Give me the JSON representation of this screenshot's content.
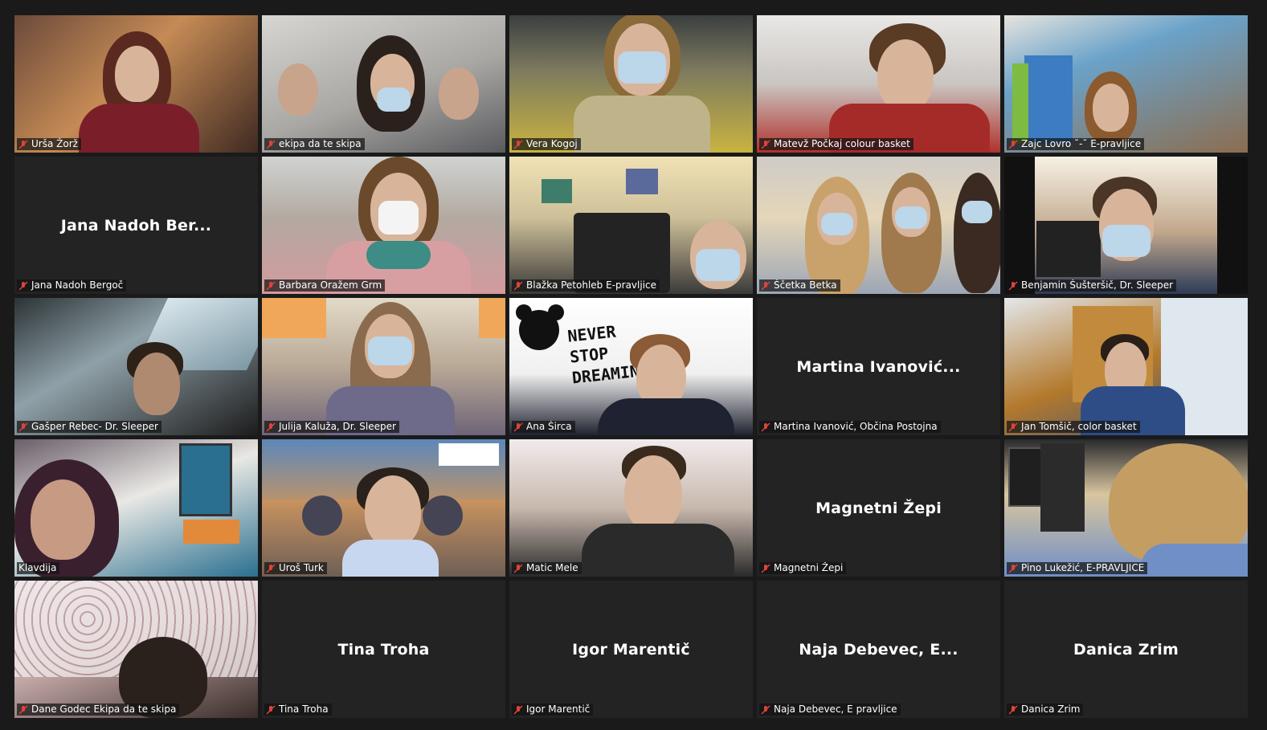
{
  "meeting": {
    "layout": "gallery-view",
    "tiles": [
      {
        "id": "urs",
        "name": "Urša Žorž",
        "display": "video",
        "muted": true
      },
      {
        "id": "ekipa",
        "name": "ekipa da te skipa",
        "display": "video",
        "muted": true
      },
      {
        "id": "vera",
        "name": "Vera Kogoj",
        "display": "video",
        "muted": true
      },
      {
        "id": "matevz",
        "name": "Matevž Počkaj colour basket",
        "display": "video",
        "muted": true
      },
      {
        "id": "zajc",
        "name": "Zajc Lovro ˘-˘  E-pravljice",
        "display": "video",
        "muted": true
      },
      {
        "id": "jana",
        "name": "Jana Nadoh Bergoč",
        "center_name": "Jana Nadoh Ber...",
        "display": "name",
        "muted": true
      },
      {
        "id": "barbara",
        "name": "Barbara Oražem Grm",
        "display": "video",
        "muted": true
      },
      {
        "id": "blazka",
        "name": "Blažka Petohleb E-pravljice",
        "display": "video",
        "muted": true
      },
      {
        "id": "scetka",
        "name": "Ščetka Betka",
        "display": "video",
        "muted": true
      },
      {
        "id": "benjamin",
        "name": "Benjamin Šušteršič, Dr. Sleeper",
        "display": "video",
        "muted": true
      },
      {
        "id": "gasper",
        "name": "Gašper Rebec- Dr. Sleeper",
        "display": "video",
        "muted": true
      },
      {
        "id": "julija",
        "name": "Julija Kaluža, Dr. Sleeper",
        "display": "video",
        "muted": true
      },
      {
        "id": "ana",
        "name": "Ana Širca",
        "display": "video",
        "muted": true,
        "background_text": "NEVER STOP DREAMIN"
      },
      {
        "id": "martina",
        "name": "Martina Ivanović, Občina Postojna",
        "center_name": "Martina  Ivanović...",
        "display": "name",
        "muted": true
      },
      {
        "id": "jan",
        "name": "Jan Tomšič, color basket",
        "display": "video",
        "muted": true
      },
      {
        "id": "klavdija",
        "name": "Klavdija",
        "display": "video",
        "muted": false,
        "active_speaker": true
      },
      {
        "id": "uros",
        "name": "Uroš Turk",
        "display": "video",
        "muted": true
      },
      {
        "id": "matic",
        "name": "Matic Mele",
        "display": "video",
        "muted": true
      },
      {
        "id": "magnetni",
        "name": "Magnetni Žepi",
        "center_name": "Magnetni Žepi",
        "display": "name",
        "muted": true
      },
      {
        "id": "pino",
        "name": "Pino Lukežić, E-PRAVLJICE",
        "display": "video",
        "muted": true
      },
      {
        "id": "dane",
        "name": "Dane Godec Ekipa da te skipa",
        "display": "video",
        "muted": true
      },
      {
        "id": "tina",
        "name": "Tina Troha",
        "center_name": "Tina Troha",
        "display": "name",
        "muted": true
      },
      {
        "id": "igor",
        "name": "Igor Marentič",
        "center_name": "Igor Marentič",
        "display": "name",
        "muted": true
      },
      {
        "id": "naja",
        "name": "Naja Debevec, E pravljice",
        "center_name": "Naja  Debevec,  E...",
        "display": "name",
        "muted": true
      },
      {
        "id": "danica",
        "name": "Danica Zrim",
        "center_name": "Danica Zrim",
        "display": "name",
        "muted": true
      }
    ]
  },
  "colors": {
    "background": "#1a1a1a",
    "tile_background": "#232323",
    "active_speaker_border": "#d8e86a",
    "muted_icon": "#e0423a",
    "label_text": "#ffffff"
  },
  "icons": {
    "muted": "mic-muted-icon"
  }
}
